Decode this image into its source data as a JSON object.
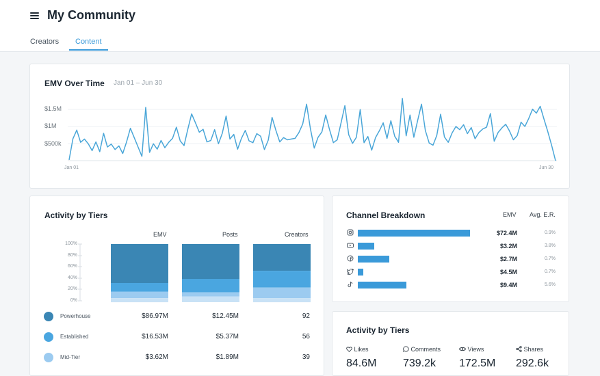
{
  "header": {
    "title": "My Community",
    "tabs": [
      {
        "label": "Creators",
        "active": false
      },
      {
        "label": "Content",
        "active": true
      }
    ]
  },
  "emv_card": {
    "title": "EMV Over Time",
    "date_range": "Jan 01 – Jun 30"
  },
  "chart_data": [
    {
      "type": "line",
      "title": "EMV Over Time",
      "xlabel": "",
      "ylabel": "",
      "x_tick_labels": [
        "Jan 01",
        "Jun 30"
      ],
      "y_tick_labels": [
        "$1.5M",
        "$1M",
        "$500k"
      ],
      "ylim": [
        0,
        1900000
      ],
      "grid": true,
      "series": [
        {
          "values": [
            20000,
            610000,
            850000,
            510000,
            600000,
            470000,
            280000,
            520000,
            250000,
            760000,
            380000,
            460000,
            310000,
            410000,
            200000,
            520000,
            900000,
            640000,
            380000,
            120000,
            1480000,
            230000,
            470000,
            320000,
            560000,
            360000,
            510000,
            620000,
            930000,
            550000,
            420000,
            880000,
            1300000,
            1050000,
            790000,
            870000,
            520000,
            560000,
            860000,
            470000,
            760000,
            1240000,
            600000,
            730000,
            320000,
            620000,
            840000,
            550000,
            500000,
            750000,
            680000,
            310000,
            570000,
            1200000,
            840000,
            520000,
            640000,
            580000,
            600000,
            620000,
            780000,
            1020000,
            1570000,
            890000,
            350000,
            650000,
            800000,
            1270000,
            860000,
            500000,
            580000,
            1050000,
            1530000,
            720000,
            480000,
            650000,
            1420000,
            500000,
            670000,
            290000,
            640000,
            830000,
            1050000,
            620000,
            1110000,
            680000,
            510000,
            1730000,
            690000,
            1270000,
            650000,
            1120000,
            1570000,
            840000,
            490000,
            430000,
            700000,
            1290000,
            660000,
            510000,
            770000,
            950000,
            860000,
            1000000,
            750000,
            920000,
            610000,
            780000,
            880000,
            930000,
            1310000,
            540000,
            780000,
            910000,
            1010000,
            820000,
            580000,
            700000,
            1070000,
            950000,
            1170000,
            1430000,
            1320000,
            1510000,
            1150000,
            800000,
            420000,
            0
          ]
        }
      ]
    },
    {
      "type": "bar",
      "title": "Activity by Tiers",
      "stacked": true,
      "normalized": true,
      "categories": [
        "EMV",
        "Posts",
        "Creators"
      ],
      "y_tick_labels": [
        "100%",
        "80%",
        "60%",
        "40%",
        "20%",
        "0%"
      ],
      "ylim": [
        0,
        100
      ],
      "series": [
        {
          "name": "Powerhouse",
          "color": "#3a86b4",
          "values": [
            67,
            60,
            46
          ]
        },
        {
          "name": "Established",
          "color": "#4aa6e0",
          "values": [
            15,
            23,
            29
          ]
        },
        {
          "name": "Mid-Tier",
          "color": "#9ccbf0",
          "values": [
            11,
            7,
            18
          ]
        },
        {
          "name": "",
          "color": "#c9e2f6",
          "values": [
            7,
            10,
            7
          ]
        }
      ],
      "value_table": [
        {
          "tier": "Powerhouse",
          "emv": "$86.97M",
          "posts": "$12.45M",
          "creators": "92"
        },
        {
          "tier": "Established",
          "emv": "$16.53M",
          "posts": "$5.37M",
          "creators": "56"
        },
        {
          "tier": "Mid-Tier",
          "emv": "$3.62M",
          "posts": "$1.89M",
          "creators": "39"
        }
      ]
    },
    {
      "type": "bar",
      "orientation": "horizontal",
      "title": "Channel Breakdown",
      "categories": [
        "instagram",
        "youtube",
        "facebook",
        "twitter",
        "tiktok"
      ],
      "series": [
        {
          "name": "EMV",
          "values": [
            72.4,
            3.2,
            2.7,
            4.5,
            9.4
          ]
        }
      ],
      "color": "#3a9ad9"
    }
  ],
  "tiers": {
    "title": "Activity by Tiers",
    "columns": [
      "EMV",
      "Posts",
      "Creators"
    ],
    "pct_labels": [
      "100%",
      "80%",
      "60%",
      "40%",
      "20%",
      "0%"
    ],
    "rows": [
      {
        "name": "Powerhouse",
        "color": "#3a86b4",
        "emv": "$86.97M",
        "posts": "$12.45M",
        "creators": "92"
      },
      {
        "name": "Established",
        "color": "#4aa6e0",
        "emv": "$16.53M",
        "posts": "$5.37M",
        "creators": "56"
      },
      {
        "name": "Mid-Tier",
        "color": "#9ccbf0",
        "emv": "$3.62M",
        "posts": "$1.89M",
        "creators": "39"
      }
    ]
  },
  "channels": {
    "title": "Channel Breakdown",
    "emv_header": "EMV",
    "er_header": "Avg. E.R.",
    "rows": [
      {
        "icon": "instagram-icon",
        "emv": "$72.4M",
        "er": "0.9%",
        "bar_fraction": 1.0
      },
      {
        "icon": "youtube-icon",
        "emv": "$3.2M",
        "er": "3.8%",
        "bar_fraction": 0.145
      },
      {
        "icon": "facebook-icon",
        "emv": "$2.7M",
        "er": "0.7%",
        "bar_fraction": 0.278
      },
      {
        "icon": "twitter-icon",
        "emv": "$4.5M",
        "er": "0.7%",
        "bar_fraction": 0.048
      },
      {
        "icon": "tiktok-icon",
        "emv": "$9.4M",
        "er": "5.6%",
        "bar_fraction": 0.43
      }
    ]
  },
  "activity": {
    "title": "Activity by Tiers",
    "metrics": [
      {
        "icon": "heart-icon",
        "label": "Likes",
        "value": "84.6M"
      },
      {
        "icon": "comment-icon",
        "label": "Comments",
        "value": "739.2k"
      },
      {
        "icon": "eye-icon",
        "label": "Views",
        "value": "172.5M"
      },
      {
        "icon": "share-icon",
        "label": "Shares",
        "value": "292.6k"
      }
    ]
  }
}
